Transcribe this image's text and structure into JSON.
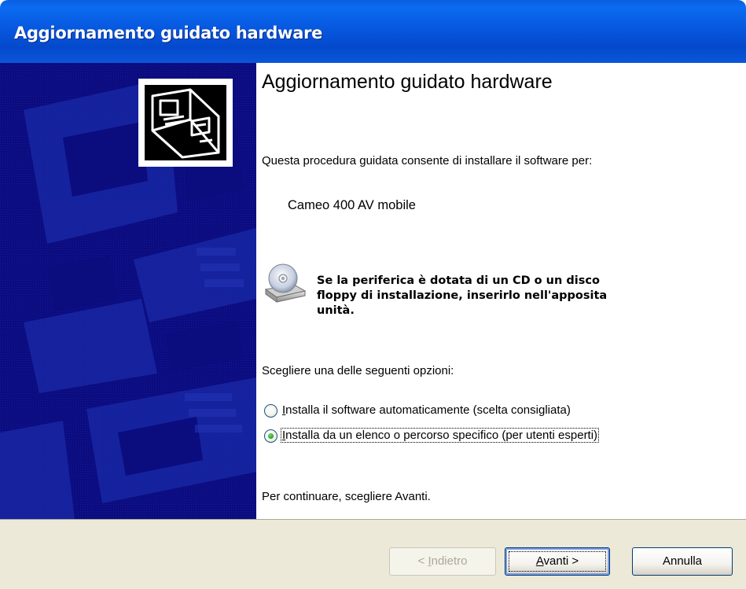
{
  "window": {
    "title": "Aggiornamento guidato hardware"
  },
  "content": {
    "heading": "Aggiornamento guidato hardware",
    "intro": "Questa procedura guidata consente di installare il software per:",
    "device_name": "Cameo 400 AV mobile",
    "notice_line1": "Se la periferica è dotata di un CD o un disco",
    "notice_line2": "floppy di installazione, inserirlo nell'apposita",
    "notice_line3": "unità.",
    "options_prompt": "Scegliere una delle seguenti opzioni:",
    "options": [
      {
        "access_key": "I",
        "label_rest": "nstalla il software automaticamente (scelta consigliata)",
        "selected": false
      },
      {
        "access_key": "I",
        "label_rest": "nstalla da un elenco o percorso specifico (per utenti esperti)",
        "selected": true
      }
    ],
    "continue_hint": "Per continuare, scegliere Avanti."
  },
  "buttons": {
    "back_prefix": "< ",
    "back_key": "I",
    "back_rest": "ndietro",
    "next_key": "A",
    "next_rest": "vanti >",
    "cancel": "Annulla"
  },
  "icons": {
    "banner_device": "hardware-device-icon",
    "cd": "cd-drive-icon"
  },
  "colors": {
    "banner_blue": "#0b0c7e",
    "titlebar_blue": "#0758df",
    "footer_gray": "#ece9d8"
  }
}
